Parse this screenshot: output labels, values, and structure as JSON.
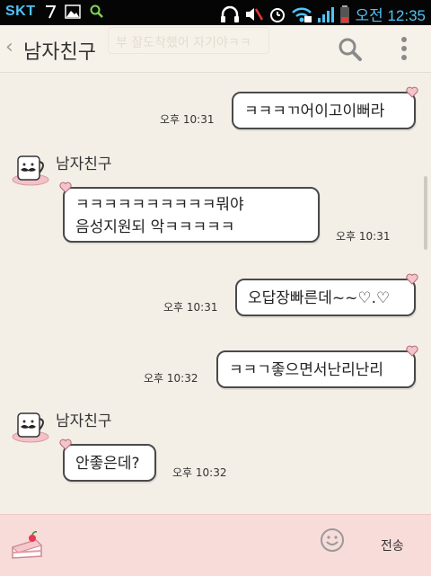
{
  "status_bar": {
    "carrier": "SKT",
    "clock": "오전 12:35"
  },
  "header": {
    "title": "남자친구",
    "ghost_banner": "부 잘도착했어 자기야ㅋㅋ"
  },
  "messages": [
    {
      "type": "sent",
      "text": "ㅋㅋㅋㄲ어이고이뻐라",
      "time": "오후 10:31"
    },
    {
      "type": "received",
      "sender": "남자친구",
      "lines": [
        "ㅋㅋㅋㅋㅋㅋㅋㅋㅋㅋ뭐야",
        "음성지원되 악ㅋㅋㅋㅋㅋ"
      ],
      "time": "오후 10:31"
    },
    {
      "type": "sent",
      "text": "오답장빠른데~~♡.♡",
      "time": "오후 10:31"
    },
    {
      "type": "sent",
      "text": "ㅋㅋㄱ좋으면서난리난리",
      "time": "오후 10:32"
    },
    {
      "type": "received",
      "sender": "남자친구",
      "lines": [
        "안좋은데?"
      ],
      "time": "오후 10:32"
    }
  ],
  "input": {
    "send_label": "전송"
  },
  "colors": {
    "status_accent": "#4fc3f7",
    "chat_background": "#f4efe6",
    "input_bar": "#f7dcd9",
    "heart": "#e8a6b3"
  }
}
